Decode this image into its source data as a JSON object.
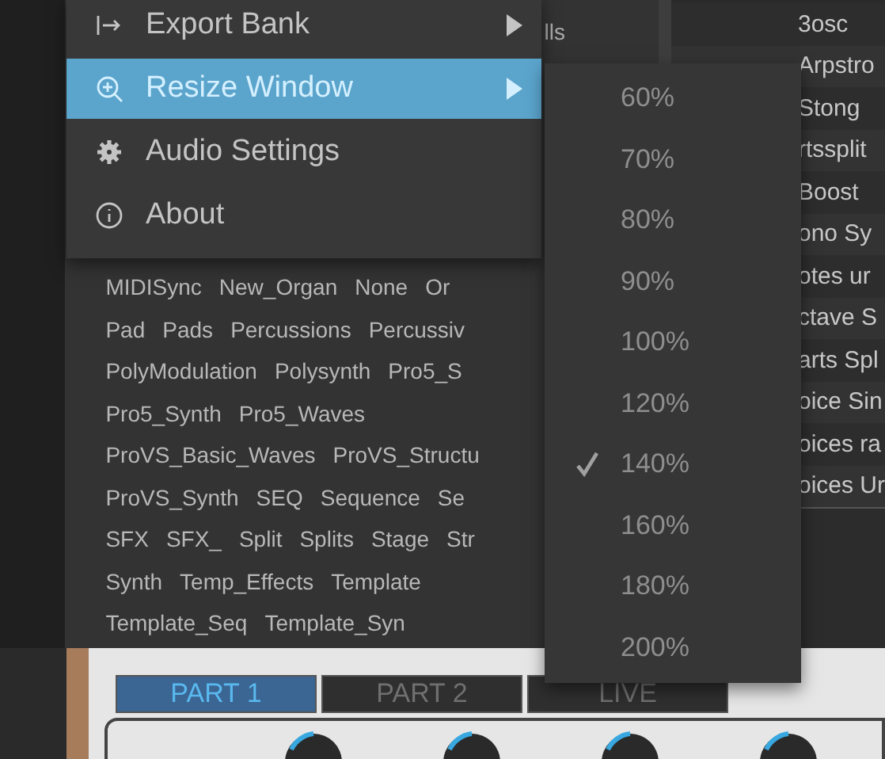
{
  "tag_fragment": "lls",
  "tag_rows": [
    {
      "tags": [
        "MIDISync",
        "New_Organ",
        "None",
        "Or"
      ]
    },
    {
      "tags": [
        "Pad",
        "Pads",
        "Percussions",
        "Percussiv"
      ]
    },
    {
      "tags": [
        "PolyModulation",
        "Polysynth",
        "Pro5_S"
      ]
    },
    {
      "tags": [
        "Pro5_Synth",
        "Pro5_Waves"
      ]
    },
    {
      "tags": [
        "ProVS_Basic_Waves",
        "ProVS_Structu"
      ]
    },
    {
      "tags": [
        "ProVS_Synth",
        "SEQ",
        "Sequence",
        "Se"
      ]
    },
    {
      "tags": [
        "SFX",
        "SFX_",
        "Split",
        "Splits",
        "Stage",
        "Str"
      ]
    },
    {
      "tags": [
        "Synth",
        "Temp_Effects",
        "Template"
      ]
    },
    {
      "tags": [
        "Template_Seq",
        "Template_Syn"
      ]
    }
  ],
  "preset_list": [
    "3osc",
    "Arpstro",
    "Stong",
    "rtssplit",
    "Boost",
    "ono Sy",
    "otes ur",
    "ctave S",
    "arts Spl",
    "oice Sin",
    "oices ra",
    "oices Ur"
  ],
  "part_tabs": [
    {
      "label": "PART 1",
      "selected": true
    },
    {
      "label": "PART 2",
      "selected": false
    },
    {
      "label": "LIVE",
      "selected": false
    }
  ],
  "menu": {
    "items": [
      {
        "kind": "export",
        "label": "Export Bank",
        "submenu": true,
        "selected": false
      },
      {
        "kind": "resize",
        "label": "Resize Window",
        "submenu": true,
        "selected": true
      },
      {
        "kind": "settings",
        "label": "Audio Settings",
        "submenu": false,
        "selected": false
      },
      {
        "kind": "about",
        "label": "About",
        "submenu": false,
        "selected": false
      }
    ]
  },
  "resize_submenu": [
    {
      "label": "60%",
      "checked": false
    },
    {
      "label": "70%",
      "checked": false
    },
    {
      "label": "80%",
      "checked": false
    },
    {
      "label": "90%",
      "checked": false
    },
    {
      "label": "100%",
      "checked": false
    },
    {
      "label": "120%",
      "checked": false
    },
    {
      "label": "140%",
      "checked": true
    },
    {
      "label": "160%",
      "checked": false
    },
    {
      "label": "180%",
      "checked": false
    },
    {
      "label": "200%",
      "checked": false
    }
  ]
}
